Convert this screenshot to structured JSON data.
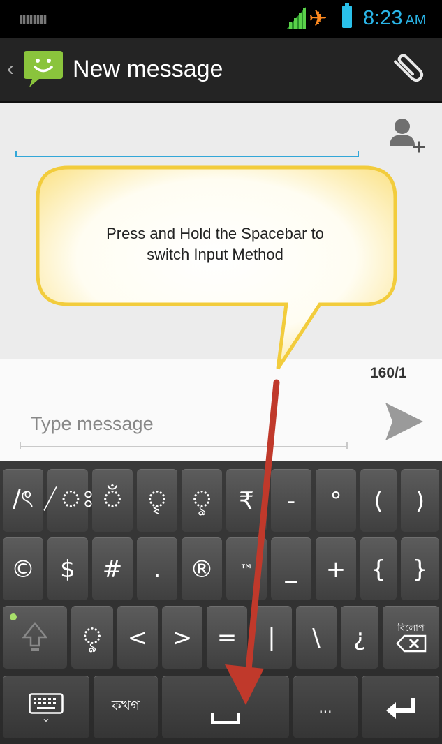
{
  "status_bar": {
    "time": "8:23",
    "ampm": "AM"
  },
  "action_bar": {
    "title": "New message"
  },
  "callout": {
    "line1": "Press and Hold the Spacebar to",
    "line2": "switch Input Method"
  },
  "composer": {
    "counter": "160/1",
    "placeholder": "Type message"
  },
  "keyboard": {
    "row1": [
      "/ৎ",
      "/ঃ",
      "ঁ",
      "ৄ",
      "ৢ",
      "₹",
      "-",
      "°",
      "(",
      ")"
    ],
    "row2": [
      "©",
      "$",
      "#",
      ".",
      "®",
      "™",
      "_",
      "+",
      "{",
      "}"
    ],
    "row3": [
      "ৢ",
      "<",
      ">",
      "=",
      "|",
      "\\",
      "¿"
    ],
    "delete_label": "বিলোপ",
    "lang_label": "কখগ",
    "more_label": "..."
  },
  "colors": {
    "accent": "#33a7d8",
    "annotation_arrow": "#c0392b",
    "callout_fill": "#fffbea",
    "callout_glow": "#f8d34a"
  }
}
